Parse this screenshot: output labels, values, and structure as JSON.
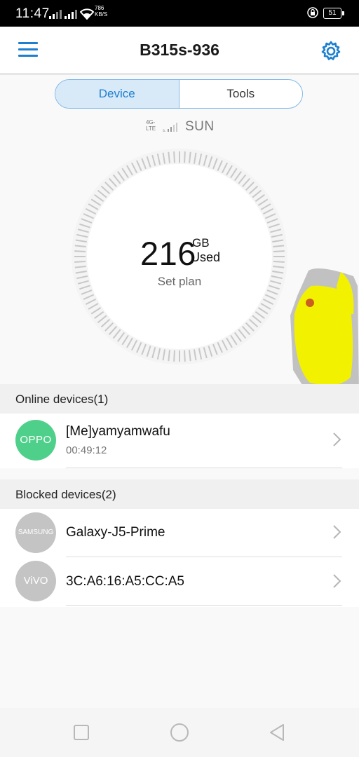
{
  "status_bar": {
    "time": "11:47",
    "net_speed_value": "786",
    "net_speed_unit": "KB/S",
    "battery": "51"
  },
  "app_bar": {
    "title": "B315s-936",
    "menu_icon": "hamburger-menu-icon",
    "settings_icon": "gear-icon"
  },
  "tabs": [
    {
      "label": "Device",
      "active": true
    },
    {
      "label": "Tools",
      "active": false
    }
  ],
  "network": {
    "type": "4G-LTE",
    "operator": "SUN"
  },
  "usage": {
    "value": "216",
    "unit": "GB",
    "caption": "Used",
    "set_plan": "Set plan"
  },
  "online_devices": {
    "header": "Online devices(1)",
    "items": [
      {
        "brand": "OPPO",
        "name": "[Me]yamyamwafu",
        "duration": "00:49:12",
        "avatar_color": "#4fd08a"
      }
    ]
  },
  "blocked_devices": {
    "header": "Blocked devices(2)",
    "items": [
      {
        "brand": "SAMSUNG",
        "name": "Galaxy-J5-Prime",
        "avatar_color": "#c4c4c4"
      },
      {
        "brand": "ViVO",
        "name": "3C:A6:16:A5:CC:A5",
        "avatar_color": "#c4c4c4"
      }
    ]
  },
  "colors": {
    "accent": "#1c7fcf",
    "tab_active_bg": "#d8e9f8",
    "redaction": "#f2f200"
  }
}
